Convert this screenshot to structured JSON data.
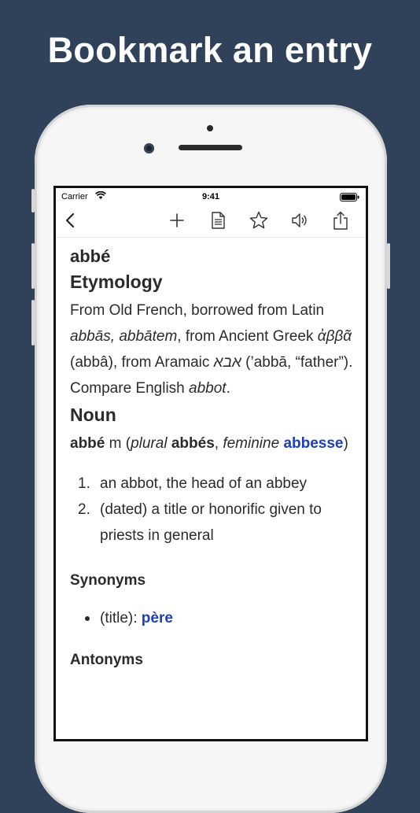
{
  "headline": "Bookmark an entry",
  "status_bar": {
    "carrier": "Carrier",
    "time": "9:41"
  },
  "nav": {
    "icons": [
      "back-chevron-icon",
      "add-icon",
      "document-icon",
      "star-icon",
      "speaker-icon",
      "share-icon"
    ],
    "accent": "#333333"
  },
  "entry": {
    "word": "abbé",
    "etymology_heading": "Etymology",
    "etymology": {
      "t1": "From Old French, borrowed from Latin ",
      "i1": "abbās, abbātem",
      "t2": ", from Ancient Greek ",
      "i2": "ἀββᾶ",
      "t3": " (abbâ), from Aramaic ",
      "i3": "אבא",
      "t4": " (’abbā, “father”). Compare English ",
      "i4": "abbot",
      "t5": "."
    },
    "noun_heading": "Noun",
    "headword_line": {
      "word": "abbé",
      "gender": " m (",
      "plural_label": "plural",
      "plural_word": "abbés",
      "sep": ", ",
      "feminine_label": "feminine",
      "feminine_word": "abbesse",
      "close": ")"
    },
    "senses": [
      {
        "num": "1.",
        "text": "an abbot, the head of an abbey"
      },
      {
        "num": "2.",
        "text": "(dated) a title or honorific given to priests in general"
      }
    ],
    "synonyms_heading": "Synonyms",
    "synonyms": {
      "prefix": "(title): ",
      "link": "père"
    },
    "antonyms_heading": "Antonyms"
  },
  "colors": {
    "background": "#2f4259",
    "link": "#1a3fbf"
  }
}
